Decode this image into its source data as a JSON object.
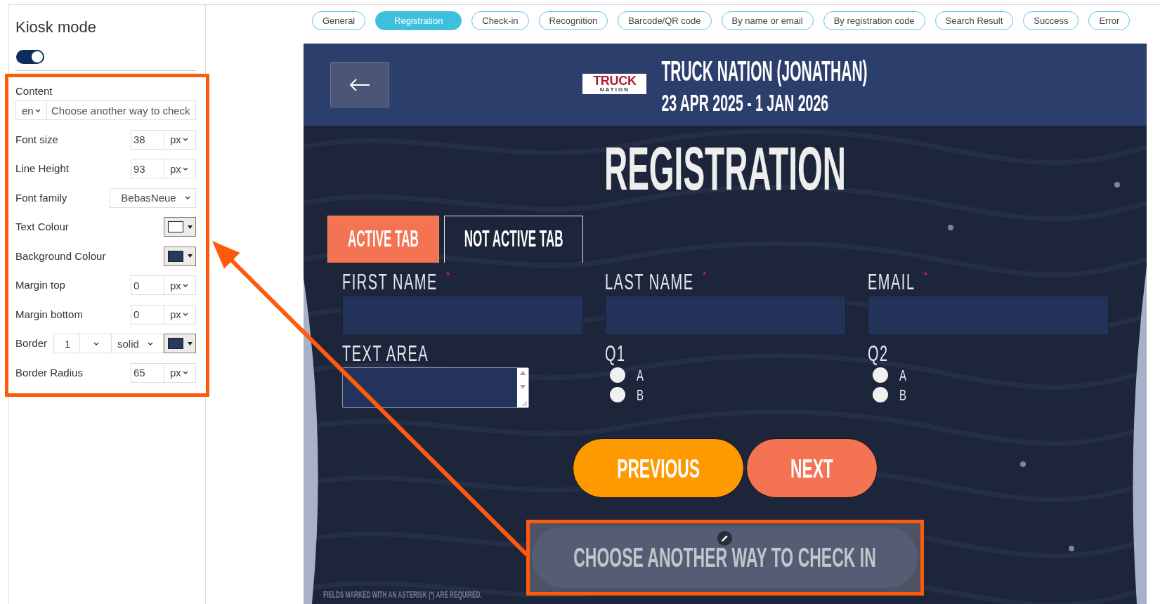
{
  "sidebar": {
    "title": "Kiosk mode",
    "toggle": {
      "on": true
    },
    "content": {
      "label": "Content",
      "language": "en",
      "value": "Choose another way to check"
    },
    "settings": [
      {
        "kind": "number",
        "label": "Font size",
        "value": "38",
        "unit": "px"
      },
      {
        "kind": "number",
        "label": "Line Height",
        "value": "93",
        "unit": "px"
      },
      {
        "kind": "select",
        "label": "Font family",
        "value": "BebasNeue"
      },
      {
        "kind": "color",
        "label": "Text Colour",
        "color": "#ffffff"
      },
      {
        "kind": "color",
        "label": "Background Colour",
        "color": "#283860"
      },
      {
        "kind": "number",
        "label": "Margin top",
        "value": "0",
        "unit": "px"
      },
      {
        "kind": "number",
        "label": "Margin bottom",
        "value": "0",
        "unit": "px"
      },
      {
        "kind": "border",
        "label": "Border",
        "value": "1",
        "style": "solid",
        "color": "#283860"
      },
      {
        "kind": "number",
        "label": "Border Radius",
        "value": "65",
        "unit": "px"
      }
    ]
  },
  "tabs": [
    {
      "label": "General",
      "selected": false
    },
    {
      "label": "Registration",
      "selected": true
    },
    {
      "label": "Check-in",
      "selected": false
    },
    {
      "label": "Recognition",
      "selected": false
    },
    {
      "label": "Barcode/QR code",
      "selected": false
    },
    {
      "label": "By name or email",
      "selected": false
    },
    {
      "label": "By registration code",
      "selected": false
    },
    {
      "label": "Search Result",
      "selected": false
    },
    {
      "label": "Success",
      "selected": false
    },
    {
      "label": "Error",
      "selected": false
    }
  ],
  "kiosk": {
    "header": {
      "logo": [
        "TRUCK",
        "NATION"
      ],
      "title": "TRUCK NATION (JONATHAN)",
      "dates": "23 APR 2025 - 1 JAN 2026"
    },
    "heading": "REGISTRATION",
    "form_tabs": [
      {
        "label": "ACTIVE TAB",
        "selected": true
      },
      {
        "label": "NOT ACTIVE TAB",
        "selected": false
      }
    ],
    "fields": [
      {
        "kind": "input",
        "label": "FIRST NAME",
        "required_mark": "*"
      },
      {
        "kind": "input",
        "label": "LAST NAME",
        "required_mark": "*"
      },
      {
        "kind": "input",
        "label": "EMAIL",
        "required_mark": "*"
      },
      {
        "kind": "textarea",
        "label": "TEXT AREA"
      },
      {
        "kind": "radio",
        "label": "Q1",
        "options": [
          {
            "label": "A",
            "selected": false
          },
          {
            "label": "B",
            "selected": false
          }
        ]
      },
      {
        "kind": "radio",
        "label": "Q2",
        "options": [
          {
            "label": "A",
            "selected": false
          },
          {
            "label": "B",
            "selected": false
          }
        ]
      }
    ],
    "buttons": [
      {
        "label": "PREVIOUS",
        "color": "#ff9900"
      },
      {
        "label": "NEXT",
        "color": "#f47352"
      }
    ],
    "alt_button": {
      "label": "CHOOSE ANOTHER WAY TO CHECK IN"
    },
    "footnote": "FIELDS MARKED WITH AN ASTERISK (*) ARE REQUIRED."
  }
}
